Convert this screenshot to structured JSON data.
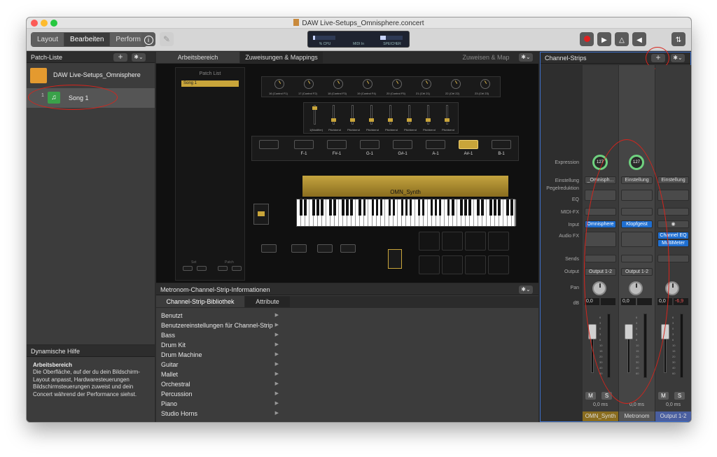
{
  "window": {
    "title": "DAW Live-Setups_Omnisphere.concert"
  },
  "toolbar": {
    "layout_label": "Layout",
    "edit_label": "Bearbeiten",
    "perform_label": "Perform",
    "lcd": {
      "cpu_label": "% CPU",
      "midi_label": "MIDI In",
      "memory_label": "SPEICHER",
      "cpu_fraction": 0.1,
      "memory_fraction": 0.25
    }
  },
  "patch_list": {
    "title": "Patch-Liste",
    "concert_name": "DAW Live-Setups_Omnisphere",
    "patches": [
      {
        "number": "1",
        "name": "Song 1"
      }
    ]
  },
  "help": {
    "title": "Dynamische Hilfe",
    "heading": "Arbeitsbereich",
    "text": "Die Oberfläche, auf der du dein Bildschirm-Layout anpasst, Hardwaresteuerungen Bildschirmsteuerungen zuweist und dein Concert während der Performance siehst."
  },
  "main_tabs": {
    "workspace": "Arbeitsbereich",
    "assignments": "Zuweisungen & Mappings",
    "assign_map": "Zuweisen & Map"
  },
  "workspace": {
    "patch_list_title": "Patch List",
    "song_entry": "Song 1",
    "set_label": "Set",
    "patch_label": "Patch",
    "knob_labels": [
      "16 (Control F1)",
      "17 (Control F2)",
      "18 (Control F3)",
      "19 (Control F4)",
      "20 (Control F5)",
      "21 (Ctrl 21)",
      "22 (Ctrl 22)",
      "23 (Ctrl 23)"
    ],
    "fader_labels": [
      "1(Modifier)",
      "Pitchbend",
      "Pitchbend",
      "Pitchbend",
      "Pitchbend",
      "Pitchbend",
      "Pitchbend",
      "Pitchbend"
    ],
    "note_buttons": [
      "F-1",
      "F#-1",
      "G-1",
      "G#-1",
      "A-1",
      "A#-1",
      "B-1"
    ],
    "synth_label": "OMN_Synth"
  },
  "info_panel": {
    "title": "Metronom-Channel-Strip-Informationen",
    "tab_library": "Channel-Strip-Bibliothek",
    "tab_attributes": "Attribute",
    "library_items": [
      "Benutzt",
      "Benutzereinstellungen für Channel-Strip",
      "Bass",
      "Drum Kit",
      "Drum Machine",
      "Guitar",
      "Mallet",
      "Orchestral",
      "Percussion",
      "Piano",
      "Studio Horns"
    ]
  },
  "channel_strips": {
    "title": "Channel-Strips",
    "row_labels": {
      "expression": "Expression",
      "setting": "Einstellung",
      "gain_reduction": "Pegelreduktion",
      "eq": "EQ",
      "midi_fx": "MIDI-FX",
      "input": "Input",
      "audio_fx": "Audio FX",
      "sends": "Sends",
      "output": "Output",
      "pan": "Pan",
      "db": "dB"
    },
    "strips": [
      {
        "name": "OMN_Synth",
        "expression": "127",
        "setting": "_Omnisph...",
        "input": "Omnisphere",
        "audio_fx": "",
        "output": "Output 1-2",
        "db_value": "0,0",
        "db_peak": "",
        "latency": "0,0 ms",
        "mute": "M",
        "solo": "S",
        "name_color": "#8a6d1f"
      },
      {
        "name": "Metronom",
        "expression": "127",
        "setting": "Einstellung",
        "input": "Klopfgeist",
        "audio_fx": "",
        "output": "Output 1-2",
        "db_value": "0,0",
        "db_peak": "",
        "latency": "0,0 ms",
        "mute": "",
        "solo": "",
        "name_color": "#555555"
      },
      {
        "name": "Output 1-2",
        "expression": "",
        "setting": "Einstellung",
        "input": "",
        "audio_fx": "Channel EQ",
        "audio_fx2": "MultiMeter",
        "output": "",
        "db_value": "0,0",
        "db_peak": "-6,9",
        "latency": "0,0 ms",
        "mute": "M",
        "solo": "S",
        "name_color": "#4a5fa0"
      }
    ],
    "fader_scale": [
      "6",
      "3",
      "0",
      "3",
      "6",
      "10",
      "15",
      "20",
      "30",
      "40",
      "60"
    ]
  }
}
